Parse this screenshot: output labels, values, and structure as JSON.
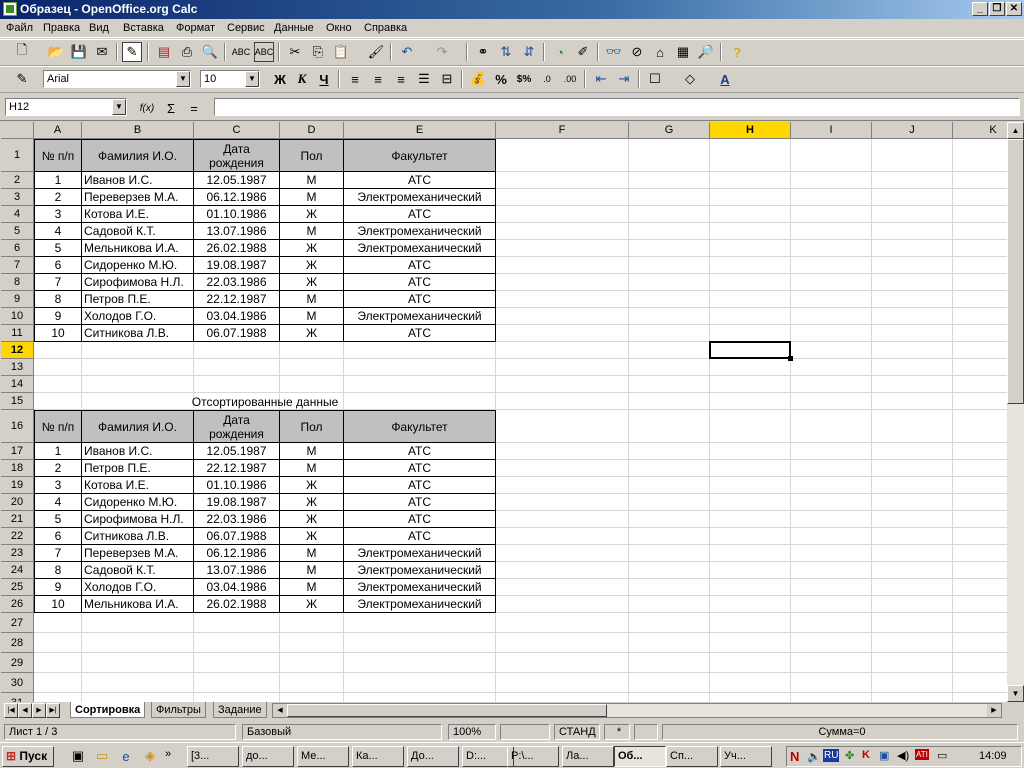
{
  "window": {
    "title": "Образец - OpenOffice.org Calc"
  },
  "menu": [
    "Файл",
    "Правка",
    "Вид",
    "Вставка",
    "Формат",
    "Сервис",
    "Данные",
    "Окно",
    "Справка"
  ],
  "format": {
    "font_name": "Arial",
    "font_size": "10",
    "bold": "Ж",
    "italic": "К",
    "underline": "Ч",
    "percent": "%",
    "currency": "$%",
    "decimal_add": ".0",
    "decimal_del": ".00"
  },
  "formula": {
    "cell_ref": "H12",
    "fx": "f(x)",
    "sum": "Σ",
    "equals": "=",
    "value": ""
  },
  "columns": [
    "A",
    "B",
    "C",
    "D",
    "E",
    "F",
    "G",
    "H",
    "I",
    "J",
    "K"
  ],
  "rows": [
    "1",
    "2",
    "3",
    "4",
    "5",
    "6",
    "7",
    "8",
    "9",
    "10",
    "11",
    "12",
    "13",
    "14",
    "15",
    "16",
    "17",
    "18",
    "19",
    "20",
    "21",
    "22",
    "23",
    "24",
    "25",
    "26",
    "27",
    "28",
    "29",
    "30",
    "31"
  ],
  "table1": {
    "headers": [
      "№ п/п",
      "Фамилия И.О.",
      "Дата рождения",
      "Пол",
      "Факультет"
    ],
    "rows": [
      [
        "1",
        "Иванов И.С.",
        "12.05.1987",
        "М",
        "АТС"
      ],
      [
        "2",
        "Переверзев М.А.",
        "06.12.1986",
        "М",
        "Электромеханический"
      ],
      [
        "3",
        "Котова И.Е.",
        "01.10.1986",
        "Ж",
        "АТС"
      ],
      [
        "4",
        "Садовой К.Т.",
        "13.07.1986",
        "М",
        "Электромеханический"
      ],
      [
        "5",
        "Мельникова И.А.",
        "26.02.1988",
        "Ж",
        "Электромеханический"
      ],
      [
        "6",
        "Сидоренко М.Ю.",
        "19.08.1987",
        "Ж",
        "АТС"
      ],
      [
        "7",
        "Сирофимова Н.Л.",
        "22.03.1986",
        "Ж",
        "АТС"
      ],
      [
        "8",
        "Петров П.Е.",
        "22.12.1987",
        "М",
        "АТС"
      ],
      [
        "9",
        "Холодов Г.О.",
        "03.04.1986",
        "М",
        "Электромеханический"
      ],
      [
        "10",
        "Ситникова Л.В.",
        "06.07.1988",
        "Ж",
        "АТС"
      ]
    ]
  },
  "sorted_caption": "Отсортированные данные",
  "table2": {
    "headers": [
      "№ п/п",
      "Фамилия И.О.",
      "Дата рождения",
      "Пол",
      "Факультет"
    ],
    "rows": [
      [
        "1",
        "Иванов И.С.",
        "12.05.1987",
        "М",
        "АТС"
      ],
      [
        "2",
        "Петров П.Е.",
        "22.12.1987",
        "М",
        "АТС"
      ],
      [
        "3",
        "Котова И.Е.",
        "01.10.1986",
        "Ж",
        "АТС"
      ],
      [
        "4",
        "Сидоренко М.Ю.",
        "19.08.1987",
        "Ж",
        "АТС"
      ],
      [
        "5",
        "Сирофимова Н.Л.",
        "22.03.1986",
        "Ж",
        "АТС"
      ],
      [
        "6",
        "Ситникова Л.В.",
        "06.07.1988",
        "Ж",
        "АТС"
      ],
      [
        "7",
        "Переверзев М.А.",
        "06.12.1986",
        "М",
        "Электромеханический"
      ],
      [
        "8",
        "Садовой К.Т.",
        "13.07.1986",
        "М",
        "Электромеханический"
      ],
      [
        "9",
        "Холодов Г.О.",
        "03.04.1986",
        "М",
        "Электромеханический"
      ],
      [
        "10",
        "Мельникова И.А.",
        "26.02.1988",
        "Ж",
        "Электромеханический"
      ]
    ]
  },
  "sheet_tabs": [
    "Сортировка",
    "Фильтры",
    "Задание"
  ],
  "active_tab": "Сортировка",
  "status": {
    "sheet": "Лист 1 / 3",
    "style": "Базовый",
    "zoom": "100%",
    "mode": "СТАНД",
    "modified": "*",
    "sum": "Сумма=0"
  },
  "taskbar": {
    "start": "Пуск",
    "items": [
      "[3...",
      "до...",
      "Ме...",
      "Ка...",
      "До...",
      "D:...",
      "P:\\...",
      "Ла...",
      "Об...",
      "Сп...",
      "Уч..."
    ],
    "tray": [
      "N",
      "RU",
      "K",
      "ATI"
    ],
    "clock": "14:09"
  },
  "colors": {
    "title_start": "#0a246a",
    "header_fill": "#c0c0c0",
    "selected_header": "#ffd700"
  }
}
